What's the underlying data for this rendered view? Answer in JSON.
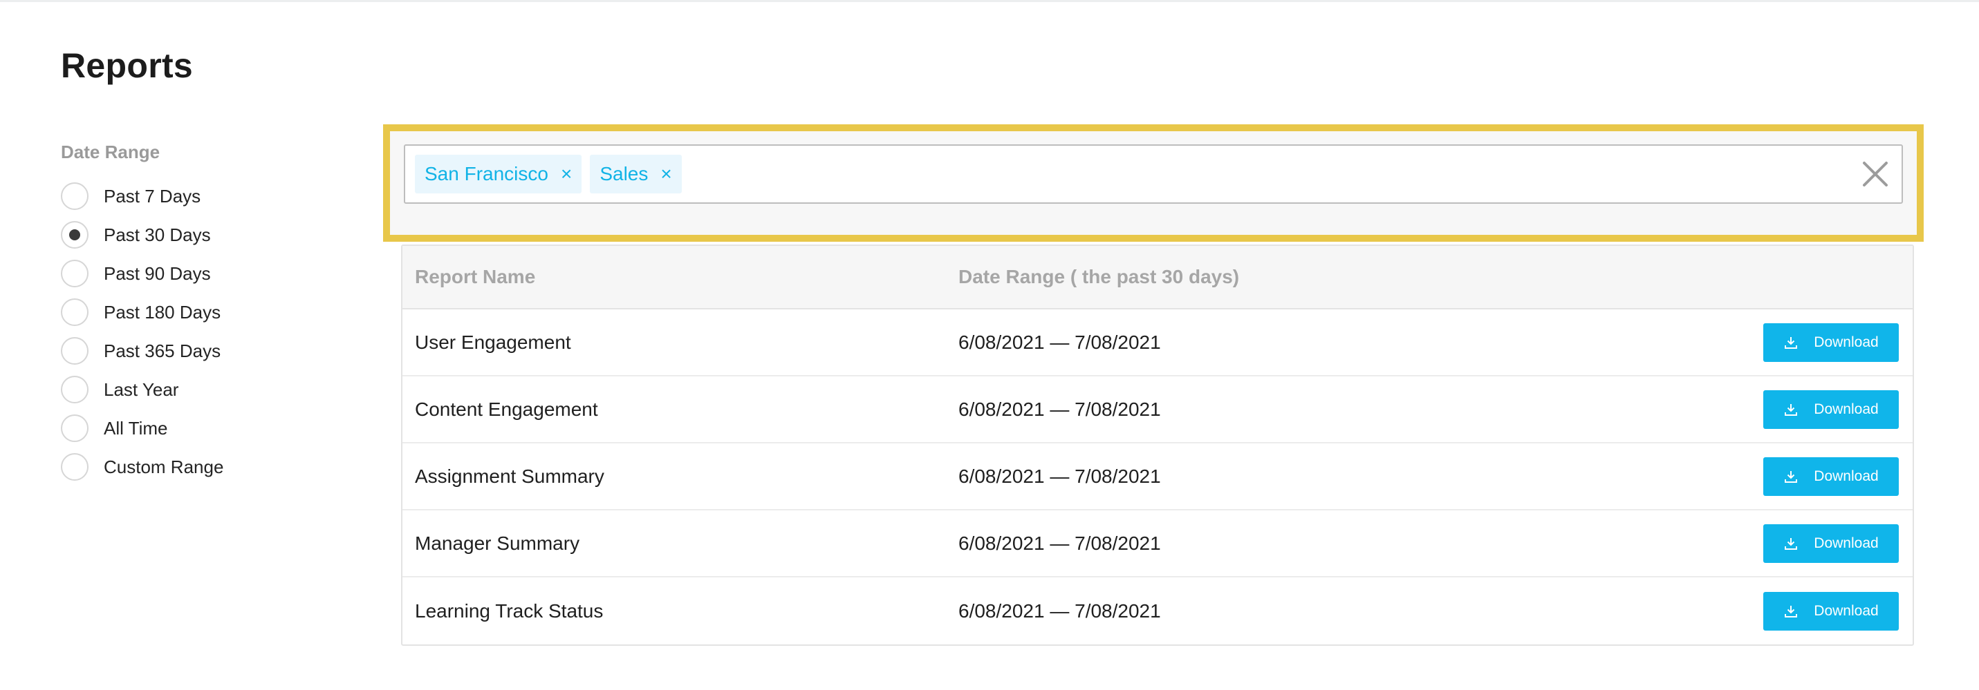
{
  "page": {
    "title": "Reports"
  },
  "sidebar": {
    "heading": "Date Range",
    "options": [
      {
        "label": "Past 7 Days",
        "selected": false
      },
      {
        "label": "Past 30 Days",
        "selected": true
      },
      {
        "label": "Past 90 Days",
        "selected": false
      },
      {
        "label": "Past 180 Days",
        "selected": false
      },
      {
        "label": "Past 365 Days",
        "selected": false
      },
      {
        "label": "Last Year",
        "selected": false
      },
      {
        "label": "All Time",
        "selected": false
      },
      {
        "label": "Custom Range",
        "selected": false
      }
    ]
  },
  "filters": {
    "chips": [
      {
        "label": "San Francisco",
        "remove_symbol": "×"
      },
      {
        "label": "Sales",
        "remove_symbol": "×"
      }
    ],
    "clear_icon": "close-icon"
  },
  "table": {
    "columns": {
      "name": "Report Name",
      "date": "Date Range ( the past 30 days)"
    },
    "rows": [
      {
        "name": "User Engagement",
        "date": "6/08/2021 — 7/08/2021",
        "action": "Download"
      },
      {
        "name": "Content Engagement",
        "date": "6/08/2021 — 7/08/2021",
        "action": "Download"
      },
      {
        "name": "Assignment Summary",
        "date": "6/08/2021 — 7/08/2021",
        "action": "Download"
      },
      {
        "name": "Manager Summary",
        "date": "6/08/2021 — 7/08/2021",
        "action": "Download"
      },
      {
        "name": "Learning Track Status",
        "date": "6/08/2021 — 7/08/2021",
        "action": "Download"
      }
    ]
  },
  "colors": {
    "accent": "#10b5ea",
    "highlight_frame": "#e8c74a",
    "chip_bg": "#e9f6fd"
  }
}
